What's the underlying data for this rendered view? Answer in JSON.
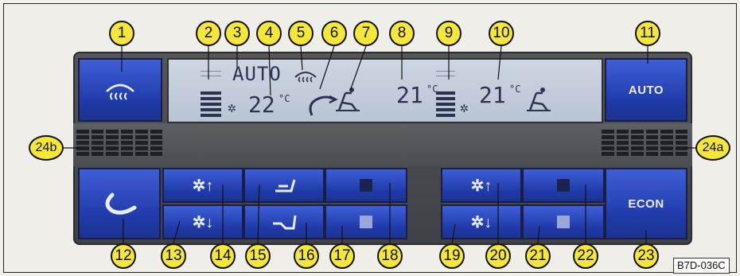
{
  "buttons": {
    "auto_label": "AUTO",
    "econ_label": "ECON"
  },
  "display": {
    "mode": "AUTO",
    "temp_left": "22",
    "temp_center": "21",
    "temp_right": "21",
    "unit": "°C"
  },
  "callouts": [
    "1",
    "2",
    "3",
    "4",
    "5",
    "6",
    "7",
    "8",
    "9",
    "10",
    "11",
    "12",
    "13",
    "14",
    "15",
    "16",
    "17",
    "18",
    "19",
    "20",
    "21",
    "22",
    "23",
    "24a",
    "24b"
  ],
  "figure_code": "B7D-036C",
  "colors": {
    "button_blue": "#2542c0",
    "callout_yellow": "#f5e63a",
    "lcd": "#c4cedc",
    "panel": "#4a4c51"
  }
}
